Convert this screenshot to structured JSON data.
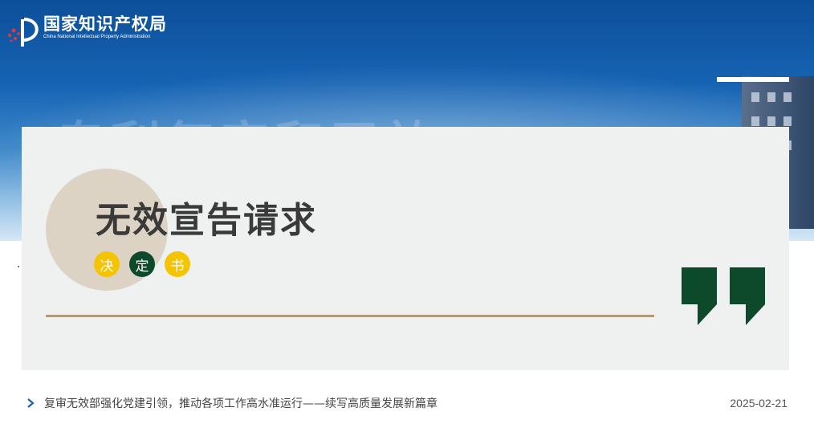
{
  "header": {
    "logo_cn": "国家知识产权局",
    "logo_en": "China National Intellectual Property Administration",
    "logo_icon": "cnipa-emblem-icon"
  },
  "hero": {
    "ghost_text": "专利复审和无效"
  },
  "side_mark": "·",
  "banner": {
    "title": "无效宣告请求",
    "tags": [
      {
        "text": "决",
        "color": "#f5c400"
      },
      {
        "text": "定",
        "color": "#0c4a2b"
      },
      {
        "text": "书",
        "color": "#f5c400"
      }
    ],
    "quote_icon": "quote-marks-icon",
    "colors": {
      "background": "#eff1f1",
      "circle": "#dcd3c5",
      "divider": "#b09a7e",
      "quote": "#0c4a2b"
    }
  },
  "news": {
    "items": [
      {
        "title": "复审无效部强化党建引领，推动各项工作高水准运行——续写高质量发展新篇章",
        "date": "2025-02-21"
      }
    ]
  }
}
